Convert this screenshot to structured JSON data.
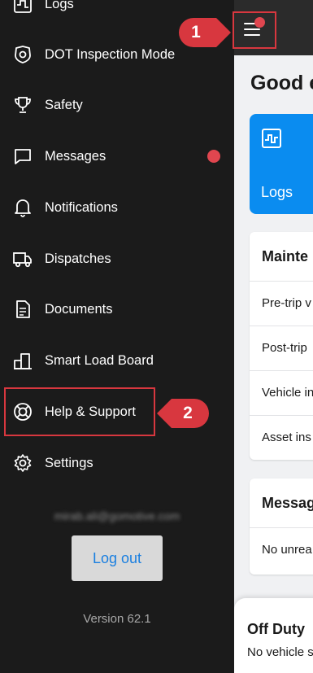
{
  "drawer": {
    "partial_top_item": {
      "label": "Logs",
      "icon": "logs-icon"
    },
    "items": [
      {
        "label": "DOT Inspection Mode",
        "icon": "shield-badge-icon",
        "badge": false
      },
      {
        "label": "Safety",
        "icon": "trophy-icon",
        "badge": false
      },
      {
        "label": "Messages",
        "icon": "chat-bubble-icon",
        "badge": true
      },
      {
        "label": "Notifications",
        "icon": "bell-icon",
        "badge": false
      },
      {
        "label": "Dispatches",
        "icon": "truck-icon",
        "badge": false
      },
      {
        "label": "Documents",
        "icon": "document-icon",
        "badge": false
      },
      {
        "label": "Smart Load Board",
        "icon": "buildings-icon",
        "badge": false
      },
      {
        "label": "Help & Support",
        "icon": "lifebuoy-icon",
        "badge": false
      },
      {
        "label": "Settings",
        "icon": "gear-icon",
        "badge": false
      }
    ],
    "email": "mirab.ali@gomotive.com",
    "logout_label": "Log out",
    "version": "Version 62.1"
  },
  "main": {
    "greeting": "Good e",
    "logs_tile_label": "Logs",
    "maintenance_card": {
      "title": "Mainte",
      "rows": [
        "Pre-trip v",
        "Post-trip",
        "Vehicle in",
        "Asset ins"
      ]
    },
    "messages_card": {
      "title": "Messag",
      "rows": [
        "No unrea"
      ]
    },
    "status_sheet": {
      "status": "Off Duty",
      "detail": "No vehicle s"
    }
  },
  "annotations": {
    "step1": "1",
    "step2": "2"
  },
  "colors": {
    "drawer_bg": "#1b1b1b",
    "accent_blue": "#0a8cf0",
    "link_blue": "#1a7fe0",
    "badge_red": "#e0464f",
    "annotation_red": "#d8373f"
  }
}
